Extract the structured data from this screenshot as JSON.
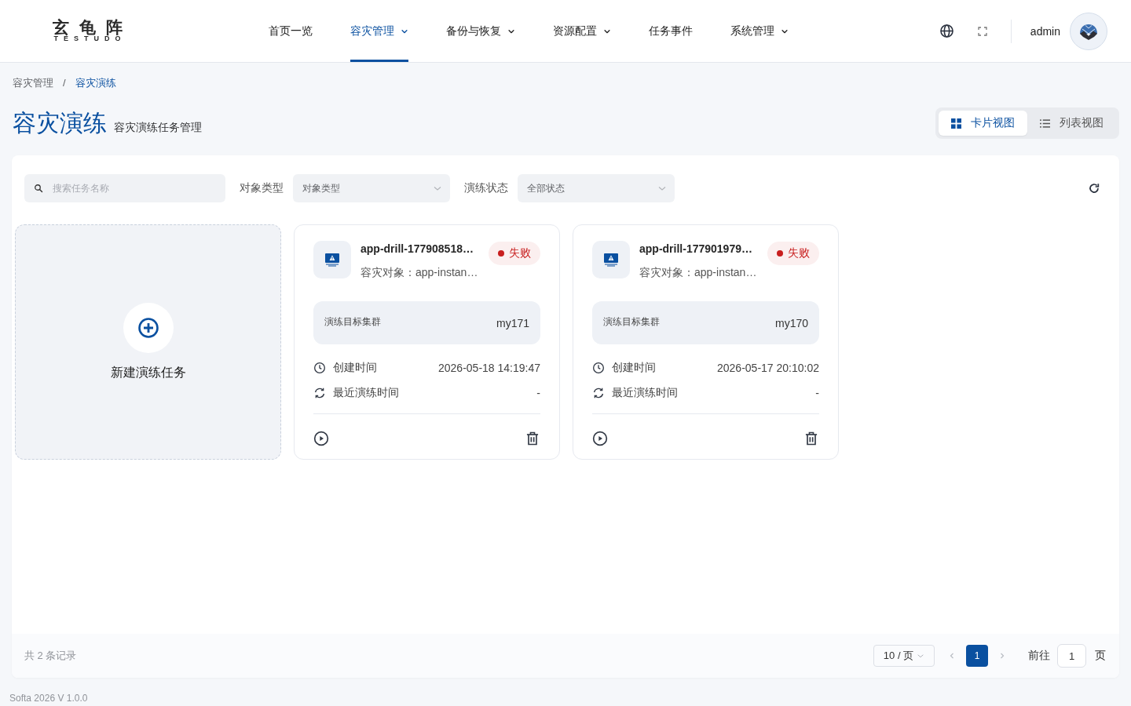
{
  "header": {
    "logo": {
      "title": "玄龟阵",
      "subtitle": "TESTUDO"
    },
    "nav": [
      {
        "label": "首页一览",
        "selected": false,
        "has_menu": false
      },
      {
        "label": "容灾管理",
        "selected": true,
        "has_menu": true
      },
      {
        "label": "备份与恢复",
        "selected": false,
        "has_menu": true
      },
      {
        "label": "资源配置",
        "selected": false,
        "has_menu": true
      },
      {
        "label": "任务事件",
        "selected": false,
        "has_menu": false
      },
      {
        "label": "系统管理",
        "selected": false,
        "has_menu": true
      }
    ],
    "user": "admin"
  },
  "breadcrumb": {
    "items": [
      {
        "label": "容灾管理",
        "selected": false
      },
      {
        "label": "容灾演练",
        "selected": true
      }
    ],
    "separator": "/"
  },
  "page": {
    "title": "容灾演练",
    "subtitle": "容灾演练任务管理"
  },
  "view_toggle": [
    {
      "label": "卡片视图",
      "kind": "grid",
      "selected": true
    },
    {
      "label": "列表视图",
      "kind": "list",
      "selected": false
    }
  ],
  "filters": {
    "search": {
      "placeholder": "搜索任务名称"
    },
    "selects": [
      {
        "label": "对象类型",
        "value": "对象类型"
      },
      {
        "label": "演练状态",
        "value": "全部状态"
      }
    ]
  },
  "new_task": {
    "label": "新建演练任务"
  },
  "tasks": [
    {
      "name": "app-drill-177908518…",
      "status": {
        "label": "失败",
        "color": "#c81e1e"
      },
      "target": "容灾对象：app-instan…",
      "cluster_label": "演练目标集群",
      "cluster": "my171",
      "fields": [
        {
          "kind": "created",
          "label": "创建时间",
          "value": "2026-05-18 14:19:47"
        },
        {
          "kind": "last_drill",
          "label": "最近演练时间",
          "value": "-"
        }
      ]
    },
    {
      "name": "app-drill-177901979…",
      "status": {
        "label": "失败",
        "color": "#c81e1e"
      },
      "target": "容灾对象：app-instan…",
      "cluster_label": "演练目标集群",
      "cluster": "my170",
      "fields": [
        {
          "kind": "created",
          "label": "创建时间",
          "value": "2026-05-17 20:10:02"
        },
        {
          "kind": "last_drill",
          "label": "最近演练时间",
          "value": "-"
        }
      ]
    }
  ],
  "pagination": {
    "total": "共 2 条记录",
    "page_size": "10 / 页",
    "pages": [
      {
        "label": "1",
        "selected": true
      }
    ],
    "goto_label": "前往",
    "goto_value": "1",
    "goto_suffix": "页"
  },
  "footer": "Softa 2026 V 1.0.0"
}
